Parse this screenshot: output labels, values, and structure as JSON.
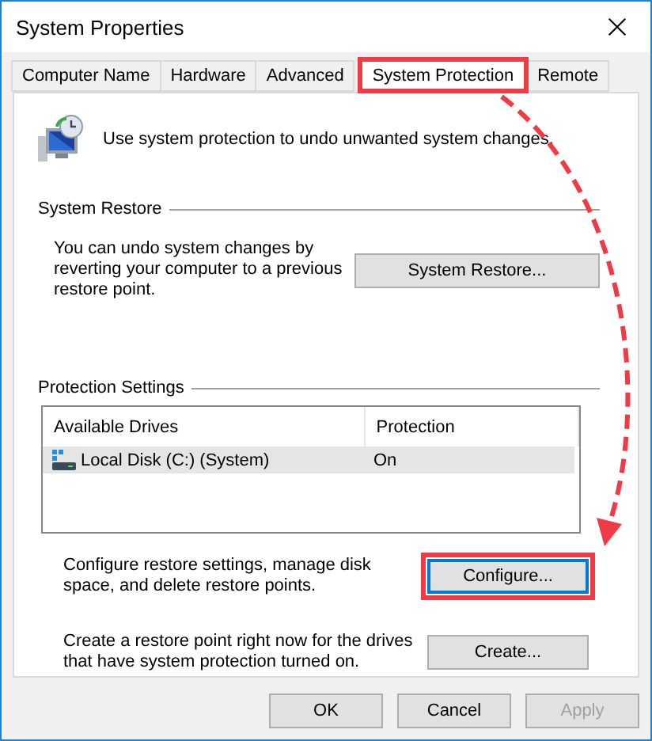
{
  "window": {
    "title": "System Properties"
  },
  "tabs": [
    {
      "label": "Computer Name",
      "selected": false,
      "highlighted": false
    },
    {
      "label": "Hardware",
      "selected": false,
      "highlighted": false
    },
    {
      "label": "Advanced",
      "selected": false,
      "highlighted": false
    },
    {
      "label": "System Protection",
      "selected": true,
      "highlighted": true
    },
    {
      "label": "Remote",
      "selected": false,
      "highlighted": false
    }
  ],
  "intro": "Use system protection to undo unwanted system changes.",
  "system_restore": {
    "heading": "System Restore",
    "text": "You can undo system changes by reverting your computer to a previous restore point.",
    "button": {
      "label": "System Restore...",
      "highlighted": false,
      "focused": false
    }
  },
  "protection_settings": {
    "heading": "Protection Settings",
    "columns": [
      "Available Drives",
      "Protection"
    ],
    "rows": [
      {
        "drive": "Local Disk (C:) (System)",
        "protection": "On",
        "selected": true
      }
    ],
    "actions": [
      {
        "text": "Configure restore settings, manage disk space, and delete restore points.",
        "button": {
          "label": "Configure...",
          "highlighted": true,
          "focused": true
        }
      },
      {
        "text": "Create a restore point right now for the drives that have system protection turned on.",
        "button": {
          "label": "Create...",
          "highlighted": false,
          "focused": false
        }
      }
    ]
  },
  "annotation": {
    "arrow": true
  },
  "buttons": [
    {
      "label": "OK",
      "disabled": false
    },
    {
      "label": "Cancel",
      "disabled": false
    },
    {
      "label": "Apply",
      "disabled": true
    }
  ]
}
